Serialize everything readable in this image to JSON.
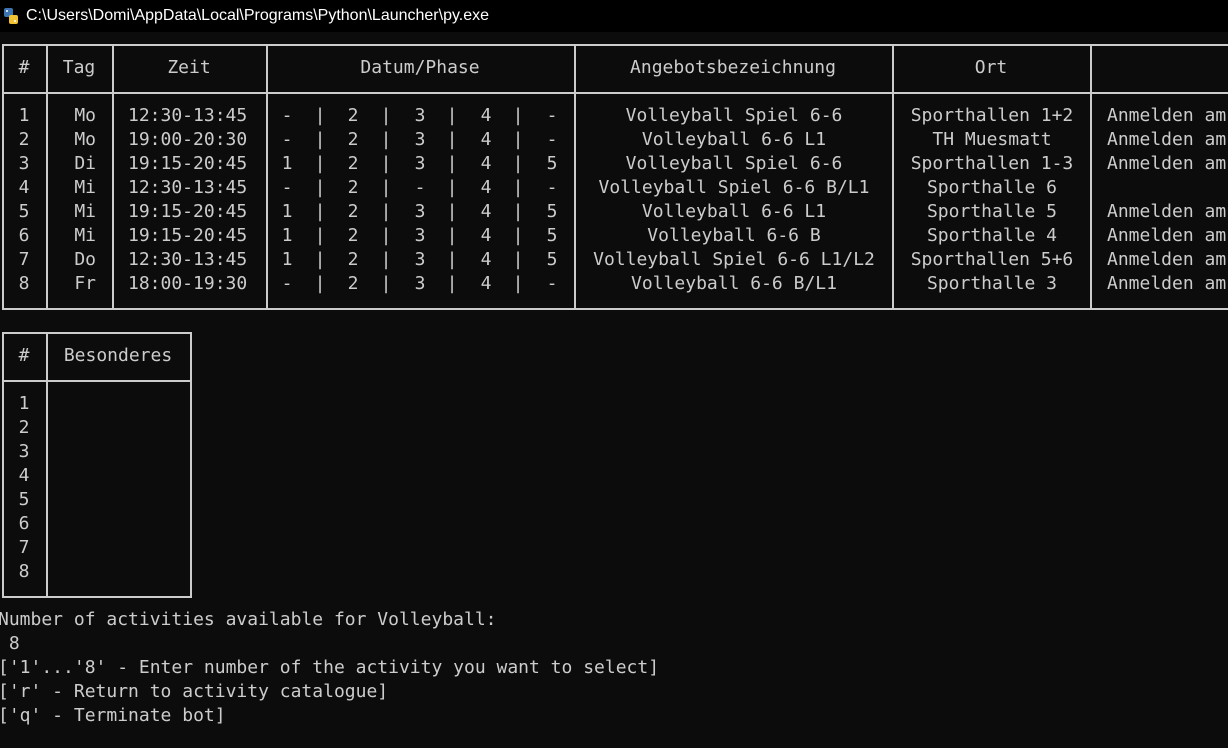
{
  "window": {
    "title": "C:\\Users\\Domi\\AppData\\Local\\Programs\\Python\\Launcher\\py.exe"
  },
  "table1": {
    "headers": [
      "#",
      "Tag",
      "Zeit",
      "Datum/Phase",
      "Angebotsbezeichnung",
      "Ort",
      ""
    ],
    "rows": [
      {
        "num": "1",
        "tag": "Mo",
        "zeit": "12:30-13:45",
        "phases": [
          "-",
          "2",
          "3",
          "4",
          "-"
        ],
        "name": "Volleyball Spiel 6-6",
        "ort": "Sporthallen 1+2",
        "note": "Anmelden am"
      },
      {
        "num": "2",
        "tag": "Mo",
        "zeit": "19:00-20:30",
        "phases": [
          "-",
          "2",
          "3",
          "4",
          "-"
        ],
        "name": "Volleyball 6-6 L1",
        "ort": "TH Muesmatt",
        "note": "Anmelden am"
      },
      {
        "num": "3",
        "tag": "Di",
        "zeit": "19:15-20:45",
        "phases": [
          "1",
          "2",
          "3",
          "4",
          "5"
        ],
        "name": "Volleyball Spiel 6-6",
        "ort": "Sporthallen 1-3",
        "note": "Anmelden am"
      },
      {
        "num": "4",
        "tag": "Mi",
        "zeit": "12:30-13:45",
        "phases": [
          "-",
          "2",
          "-",
          "4",
          "-"
        ],
        "name": "Volleyball Spiel 6-6 B/L1",
        "ort": "Sporthalle 6",
        "note": ""
      },
      {
        "num": "5",
        "tag": "Mi",
        "zeit": "19:15-20:45",
        "phases": [
          "1",
          "2",
          "3",
          "4",
          "5"
        ],
        "name": "Volleyball 6-6 L1",
        "ort": "Sporthalle 5",
        "note": "Anmelden am"
      },
      {
        "num": "6",
        "tag": "Mi",
        "zeit": "19:15-20:45",
        "phases": [
          "1",
          "2",
          "3",
          "4",
          "5"
        ],
        "name": "Volleyball 6-6 B",
        "ort": "Sporthalle 4",
        "note": "Anmelden am"
      },
      {
        "num": "7",
        "tag": "Do",
        "zeit": "12:30-13:45",
        "phases": [
          "1",
          "2",
          "3",
          "4",
          "5"
        ],
        "name": "Volleyball Spiel 6-6 L1/L2",
        "ort": "Sporthallen 5+6",
        "note": "Anmelden am"
      },
      {
        "num": "8",
        "tag": "Fr",
        "zeit": "18:00-19:30",
        "phases": [
          "-",
          "2",
          "3",
          "4",
          "-"
        ],
        "name": "Volleyball 6-6 B/L1",
        "ort": "Sporthalle 3",
        "note": "Anmelden am"
      }
    ]
  },
  "table2": {
    "headers": [
      "#",
      "Besonderes"
    ],
    "rows": [
      "1",
      "2",
      "3",
      "4",
      "5",
      "6",
      "7",
      "8"
    ]
  },
  "console": {
    "lines": [
      "Number of activities available for Volleyball:",
      " 8",
      "['1'...'8' - Enter number of the activity you want to select]",
      "['r' - Return to activity catalogue]",
      "['q' - Terminate bot]"
    ]
  }
}
